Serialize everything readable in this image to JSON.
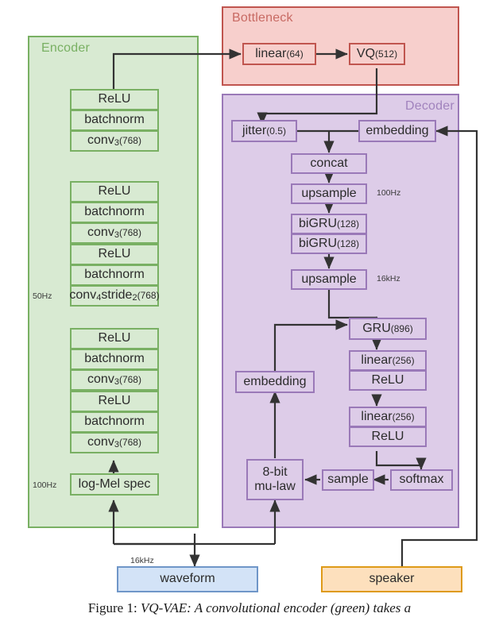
{
  "figure": {
    "caption_prefix": "Figure 1:",
    "caption_text": "VQ-VAE: A convolutional encoder (green) takes a"
  },
  "panels": {
    "encoder": {
      "title": "Encoder",
      "color": "#79b063",
      "fill": "#d8ead2"
    },
    "bottleneck": {
      "title": "Bottleneck",
      "color": "#c0554f",
      "fill": "#f7cfcc"
    },
    "decoder": {
      "title": "Decoder",
      "color": "#9a79b8",
      "fill": "#ddcce8"
    }
  },
  "encoder": {
    "blocks": [
      {
        "relu": "ReLU",
        "batchnorm": "batchnorm",
        "conv": "conv",
        "conv_sub": "3",
        "conv_arg": "(768)"
      },
      {
        "relu": "ReLU",
        "batchnorm": "batchnorm",
        "conv": "conv",
        "conv_sub": "3",
        "conv_arg": "(768)"
      },
      {
        "relu": "ReLU",
        "batchnorm": "batchnorm",
        "conv": "conv",
        "conv_sub": "4",
        "conv2": "stride",
        "conv2_sub": "2",
        "conv_arg": "(768)"
      },
      {
        "relu": "ReLU",
        "batchnorm": "batchnorm",
        "conv": "conv",
        "conv_sub": "3",
        "conv_arg": "(768)"
      },
      {
        "relu": "ReLU",
        "batchnorm": "batchnorm",
        "conv": "conv",
        "conv_sub": "3",
        "conv_arg": "(768)"
      }
    ],
    "input_node": "log-Mel spec",
    "rate_50hz": "50Hz",
    "rate_100hz": "100Hz"
  },
  "bottleneck": {
    "linear": {
      "name": "linear",
      "arg": "(64)"
    },
    "vq": {
      "name": "VQ",
      "arg": "(512)"
    }
  },
  "decoder": {
    "jitter": {
      "name": "jitter",
      "arg": "(0.5)"
    },
    "embedding_top": "embedding",
    "concat": "concat",
    "upsample_100": "upsample",
    "rate_100hz": "100Hz",
    "bigru_1": {
      "name": "biGRU",
      "arg": "(128)"
    },
    "bigru_2": {
      "name": "biGRU",
      "arg": "(128)"
    },
    "upsample_16k": "upsample",
    "rate_16khz": "16kHz",
    "gru": {
      "name": "GRU",
      "arg": "(896)"
    },
    "linear_1": {
      "name": "linear",
      "arg": "(256)"
    },
    "relu_1": "ReLU",
    "linear_2": {
      "name": "linear",
      "arg": "(256)"
    },
    "relu_2": "ReLU",
    "softmax": "softmax",
    "sample": "sample",
    "mulaw_line1": "8-bit",
    "mulaw_line2": "mu-law",
    "embedding_bottom": "embedding"
  },
  "io": {
    "waveform": "waveform",
    "waveform_rate": "16kHz",
    "speaker": "speaker"
  }
}
